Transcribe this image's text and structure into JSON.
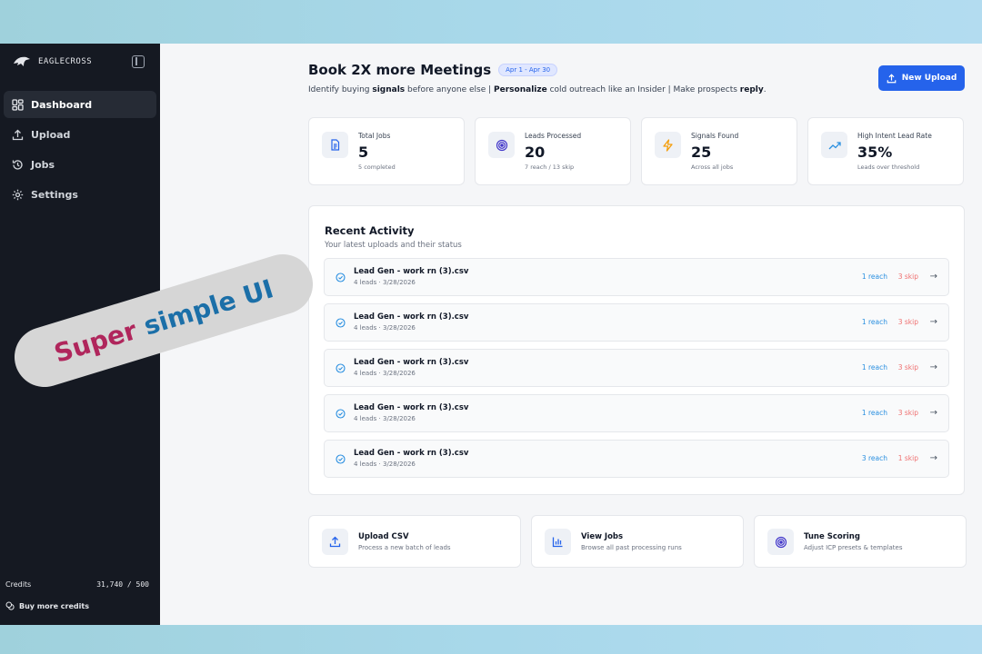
{
  "app": {
    "brand": "EAGLECROSS"
  },
  "sidebar": {
    "items": [
      {
        "label": "Dashboard",
        "icon": "dashboard-icon",
        "active": true
      },
      {
        "label": "Upload",
        "icon": "upload-icon"
      },
      {
        "label": "Jobs",
        "icon": "history-icon"
      },
      {
        "label": "Settings",
        "icon": "gear-icon"
      }
    ],
    "credits_label": "Credits",
    "credits_value": "31,740 / 500",
    "buy_credits": "Buy more credits"
  },
  "header": {
    "title": "Book 2X more Meetings",
    "date_range": "Apr 1 - Apr 30",
    "subtitle_parts": [
      "Identify buying ",
      "signals",
      " before anyone else | ",
      "Personalize",
      " cold outreach like an Insider | Make prospects ",
      "reply",
      "."
    ],
    "new_upload_label": "New Upload"
  },
  "stats": [
    {
      "label": "Total Jobs",
      "value": "5",
      "sub": "5 completed",
      "icon": "document-icon"
    },
    {
      "label": "Leads Processed",
      "value": "20",
      "sub": "7 reach / 13 skip",
      "icon": "target-icon"
    },
    {
      "label": "Signals Found",
      "value": "25",
      "sub": "Across all jobs",
      "icon": "lightning-icon"
    },
    {
      "label": "High Intent Lead Rate",
      "value": "35%",
      "sub": "Leads over threshold",
      "icon": "trending-up-icon"
    }
  ],
  "activity": {
    "title": "Recent Activity",
    "subtitle": "Your latest uploads and their status",
    "rows": [
      {
        "name": "Lead Gen - work rn (3).csv",
        "meta": "4 leads · 3/28/2026",
        "reach": "1 reach",
        "skip": "3 skip"
      },
      {
        "name": "Lead Gen - work rn (3).csv",
        "meta": "4 leads · 3/28/2026",
        "reach": "1 reach",
        "skip": "3 skip"
      },
      {
        "name": "Lead Gen - work rn (3).csv",
        "meta": "4 leads · 3/28/2026",
        "reach": "1 reach",
        "skip": "3 skip"
      },
      {
        "name": "Lead Gen - work rn (3).csv",
        "meta": "4 leads · 3/28/2026",
        "reach": "1 reach",
        "skip": "3 skip"
      },
      {
        "name": "Lead Gen - work rn (3).csv",
        "meta": "4 leads · 3/28/2026",
        "reach": "3 reach",
        "skip": "1 skip"
      }
    ]
  },
  "quick_actions": [
    {
      "title": "Upload CSV",
      "sub": "Process a new batch of leads",
      "icon": "upload-icon"
    },
    {
      "title": "View Jobs",
      "sub": "Browse all past processing runs",
      "icon": "bar-chart-icon"
    },
    {
      "title": "Tune Scoring",
      "sub": "Adjust ICP presets & templates",
      "icon": "target-icon"
    }
  ],
  "overlay": {
    "word1": "Super",
    "word2": "simple UI"
  },
  "colors": {
    "accent": "#2563eb",
    "reach": "#2a8fe0",
    "skip": "#ef7070",
    "sidebar_bg": "#151922"
  }
}
